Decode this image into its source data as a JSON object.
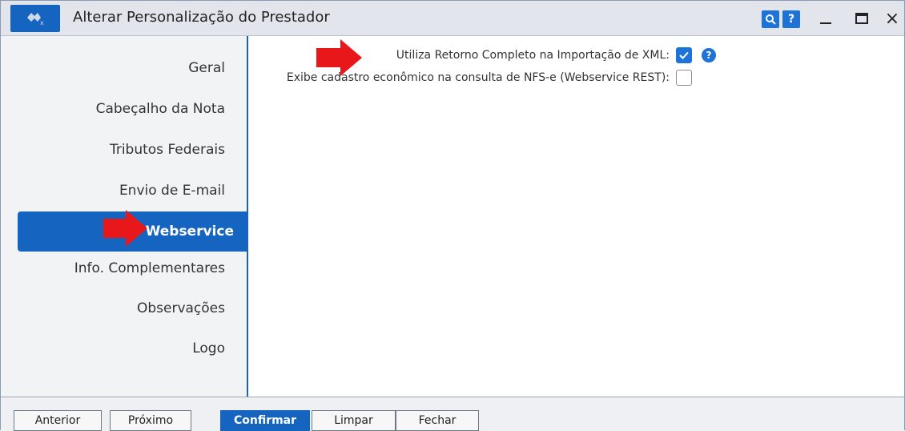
{
  "window": {
    "title": "Alterar Personalização do Prestador"
  },
  "titlebar": {
    "search_icon": "search-icon",
    "help_label": "?",
    "minimize_icon": "minimize-icon",
    "maximize_icon": "maximize-icon",
    "close_label": "×"
  },
  "sidebar": {
    "items": [
      {
        "label": "Geral"
      },
      {
        "label": "Cabeçalho da Nota"
      },
      {
        "label": "Tributos Federais"
      },
      {
        "label": "Envio de E-mail"
      },
      {
        "label": "Webservice"
      },
      {
        "label": "Info. Complementares"
      },
      {
        "label": "Observações"
      },
      {
        "label": "Logo"
      }
    ],
    "active": "Webservice"
  },
  "form": {
    "field1": {
      "label": "Utiliza Retorno Completo na Importação de XML:",
      "checked": true
    },
    "field2": {
      "label": "Exibe cadastro econômico na consulta de NFS-e (Webservice REST):",
      "checked": false
    },
    "help_label": "?"
  },
  "footer": {
    "anterior": "Anterior",
    "proximo": "Próximo",
    "confirmar": "Confirmar",
    "limpar": "Limpar",
    "fechar": "Fechar"
  },
  "colors": {
    "accent": "#1565c0",
    "checkbox": "#1e73d8",
    "annotation_arrow": "#e8171a"
  }
}
